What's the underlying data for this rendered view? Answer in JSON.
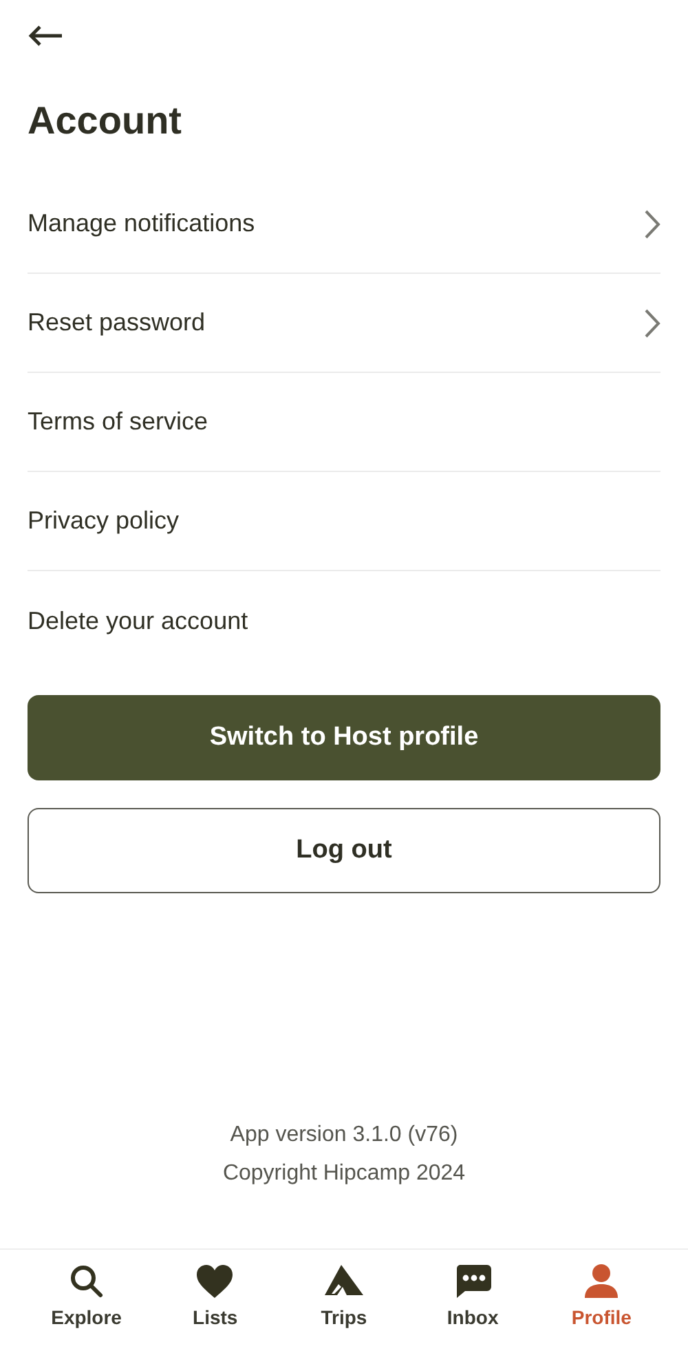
{
  "title": "Account",
  "items": [
    {
      "label": "Manage notifications",
      "chevron": true
    },
    {
      "label": "Reset password",
      "chevron": true
    },
    {
      "label": "Terms of service",
      "chevron": false
    },
    {
      "label": "Privacy policy",
      "chevron": false
    },
    {
      "label": "Delete your account",
      "chevron": false
    }
  ],
  "primary_button": "Switch to Host profile",
  "secondary_button": "Log out",
  "footer": [
    "App version 3.1.0 (v76)",
    "Copyright Hipcamp 2024"
  ],
  "nav": [
    {
      "kind": "search",
      "label": "Explore",
      "selected": false
    },
    {
      "kind": "heart",
      "label": "Lists",
      "selected": false
    },
    {
      "kind": "tent",
      "label": "Trips",
      "selected": false
    },
    {
      "kind": "chat",
      "label": "Inbox",
      "selected": false
    },
    {
      "kind": "person",
      "label": "Profile",
      "selected": true
    }
  ]
}
